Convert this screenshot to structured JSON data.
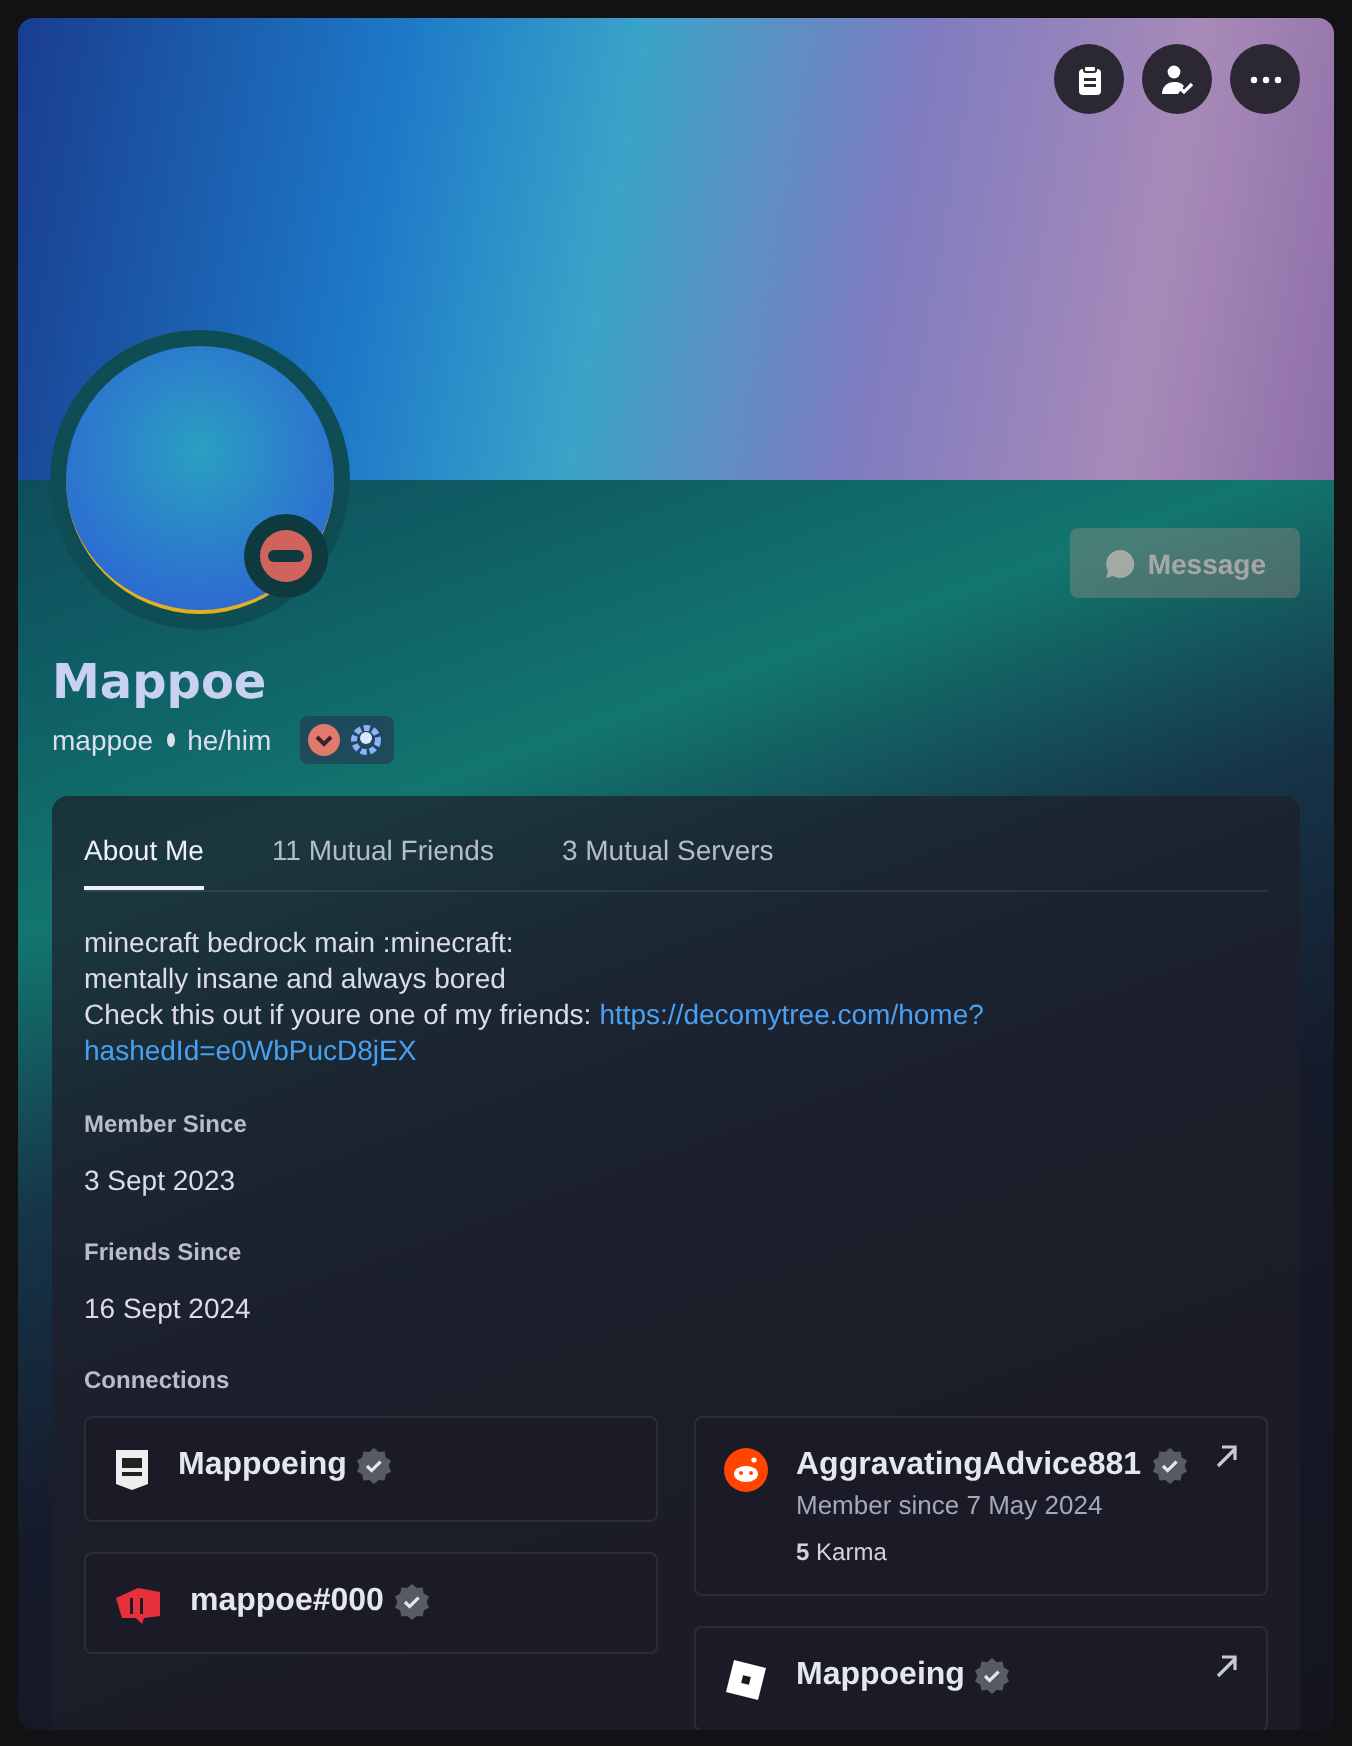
{
  "header_buttons": [
    {
      "kind": "notes"
    },
    {
      "kind": "friend"
    },
    {
      "kind": "more"
    }
  ],
  "profile": {
    "display_name": "Mappoe",
    "username": "mappoe",
    "pronouns": "he/him",
    "status": {
      "kind": "dnd"
    }
  },
  "message_button": {
    "label": "Message"
  },
  "tabs": [
    {
      "label": "About Me",
      "selected": true
    },
    {
      "label": "11 Mutual Friends",
      "selected": false
    },
    {
      "label": "3 Mutual Servers",
      "selected": false
    }
  ],
  "bio": {
    "lines": [
      "minecraft bedrock main :minecraft:",
      "mentally insane and always bored"
    ],
    "link_prefix": "Check this out if youre one of my friends:",
    "link_parts": [
      "https://decomytree.com/home?",
      "hashedId=e0WbPucD8jEX"
    ]
  },
  "sections": [
    {
      "heading": "Member Since",
      "value": "3 Sept 2023"
    },
    {
      "heading": "Friends Since",
      "value": "16 Sept 2024"
    }
  ],
  "connections": {
    "heading": "Connections",
    "columns": [
      [
        {
          "kind": "epic",
          "name": "Mappoeing",
          "verified": true,
          "external": false
        },
        {
          "kind": "riot",
          "name": "mappoe#000",
          "verified": true,
          "external": false
        }
      ],
      [
        {
          "kind": "reddit",
          "name": "AggravatingAdvice881",
          "verified": true,
          "external": true,
          "subtitle": "Member since 7 May 2024",
          "karma_value": "5",
          "karma_label": "Karma"
        },
        {
          "kind": "roblox",
          "name": "Mappoeing",
          "verified": true,
          "external": true
        }
      ]
    ]
  }
}
